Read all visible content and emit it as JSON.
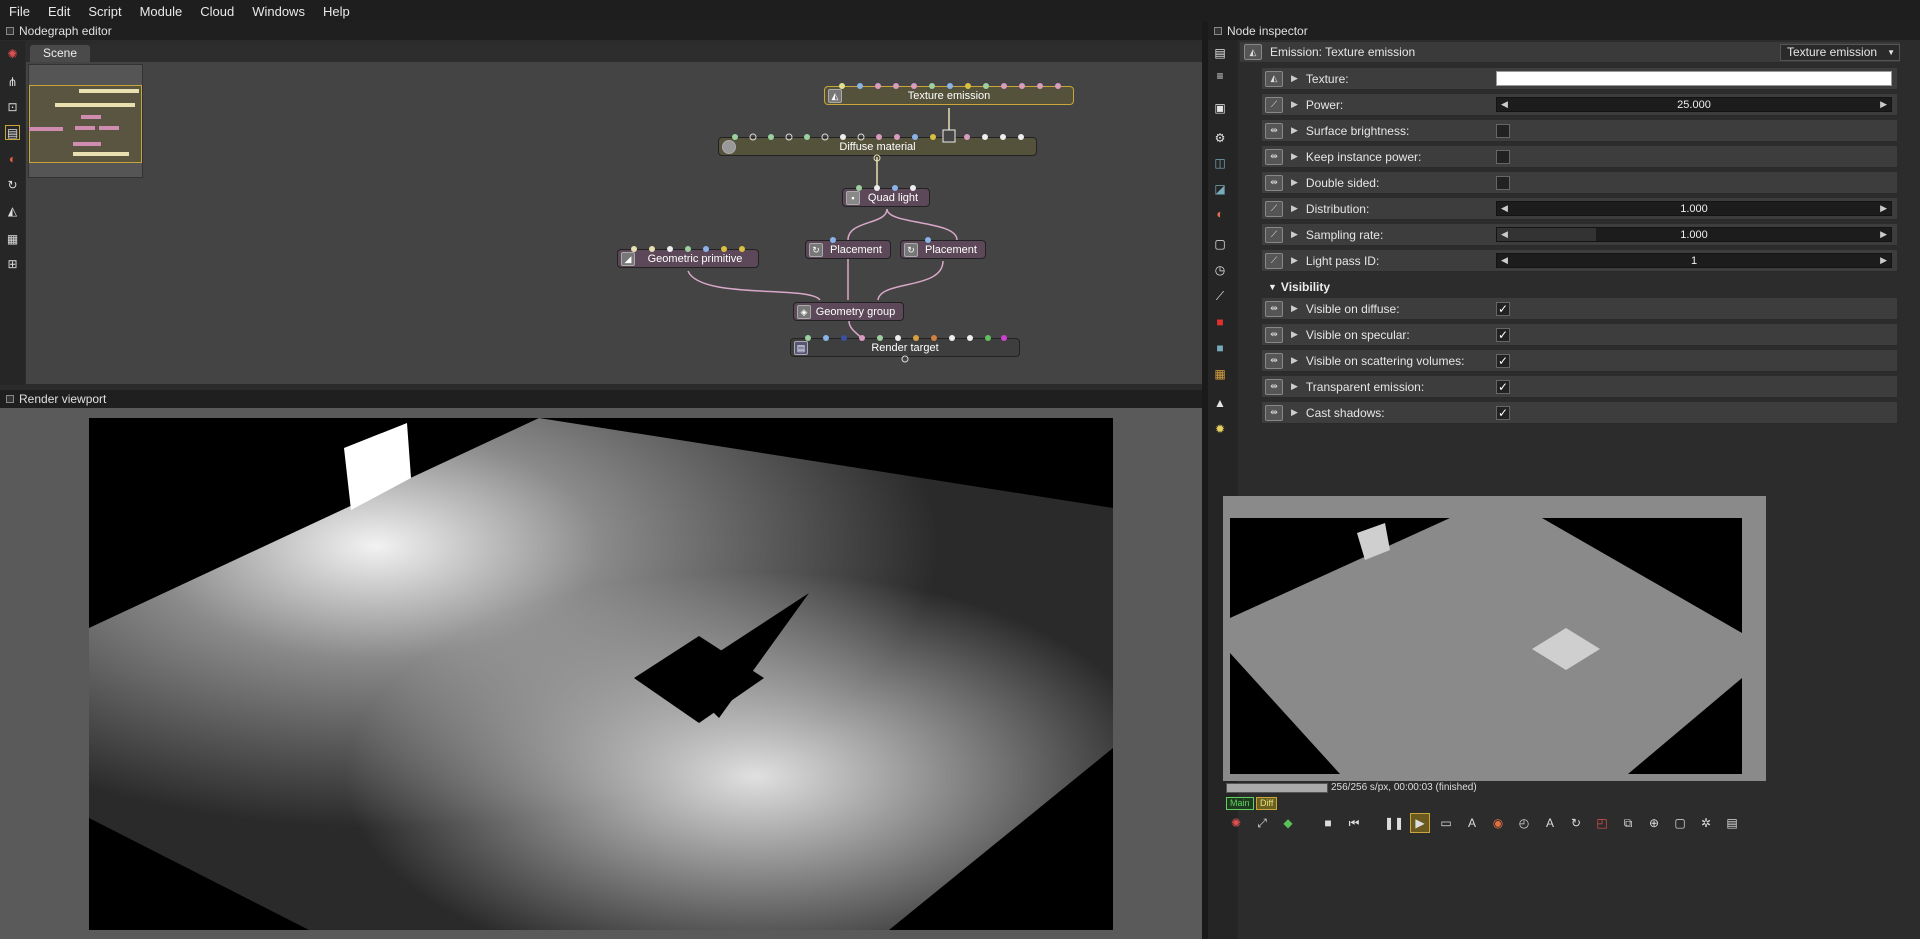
{
  "menu": [
    "File",
    "Edit",
    "Script",
    "Module",
    "Cloud",
    "Windows",
    "Help"
  ],
  "panels": {
    "nodegraph": "Nodegraph editor",
    "render": "Render viewport",
    "inspector": "Node inspector"
  },
  "nodegraph": {
    "tab": "Scene",
    "nodes": {
      "texture_emission": "Texture emission",
      "diffuse_material": "Diffuse material",
      "quad_light": "Quad light",
      "placement_1": "Placement",
      "placement_2": "Placement",
      "geometric_primitive": "Geometric primitive",
      "geometry_group": "Geometry group",
      "render_target": "Render target"
    }
  },
  "inspector": {
    "title": "Emission: Texture emission",
    "type_select": "Texture emission",
    "params": [
      {
        "label": "Texture:",
        "kind": "texture"
      },
      {
        "label": "Power:",
        "kind": "slider",
        "value": "25.000",
        "fill": 0.0
      },
      {
        "label": "Surface brightness:",
        "kind": "check",
        "checked": false
      },
      {
        "label": "Keep instance power:",
        "kind": "check",
        "checked": false
      },
      {
        "label": "Double sided:",
        "kind": "check",
        "checked": false
      },
      {
        "label": "Distribution:",
        "kind": "slider",
        "value": "1.000",
        "fill": 0.0
      },
      {
        "label": "Sampling rate:",
        "kind": "slider",
        "value": "1.000",
        "fill": 0.25
      },
      {
        "label": "Light pass ID:",
        "kind": "slider",
        "value": "1",
        "fill": 0.0
      }
    ],
    "visibility_title": "Visibility",
    "visibility": [
      {
        "label": "Visible on diffuse:",
        "checked": true
      },
      {
        "label": "Visible on specular:",
        "checked": true
      },
      {
        "label": "Visible on scattering volumes:",
        "checked": true
      },
      {
        "label": "Transparent emission:",
        "checked": true
      },
      {
        "label": "Cast shadows:",
        "checked": true
      }
    ]
  },
  "render_status": {
    "progress_text": "256/256 s/px, 00:00:03 (finished)",
    "progress": 1.0,
    "badge_main": "Main",
    "badge_diff": "Diff"
  },
  "colors": {
    "accent": "#c9a53a",
    "node_pink": "#5c4858",
    "node_olive": "#55523c"
  }
}
